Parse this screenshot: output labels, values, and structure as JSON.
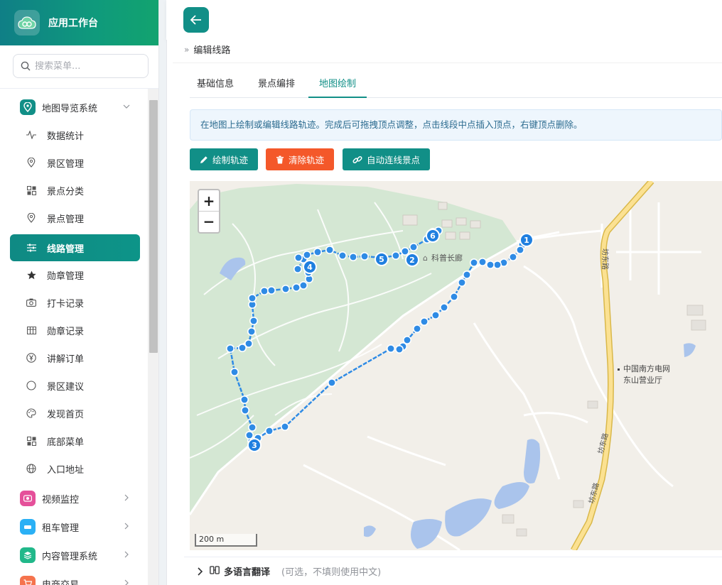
{
  "brand": {
    "title": "应用工作台"
  },
  "search": {
    "placeholder": "搜索菜单..."
  },
  "sidebar": {
    "group": {
      "label": "地图导览系统",
      "icon": "map-pin-icon"
    },
    "items": [
      {
        "label": "数据统计",
        "icon": "activity-icon"
      },
      {
        "label": "景区管理",
        "icon": "location-icon"
      },
      {
        "label": "景点分类",
        "icon": "grid-icon"
      },
      {
        "label": "景点管理",
        "icon": "location-icon"
      },
      {
        "label": "线路管理",
        "icon": "sliders-icon"
      },
      {
        "label": "勋章管理",
        "icon": "star-icon"
      },
      {
        "label": "打卡记录",
        "icon": "camera-icon"
      },
      {
        "label": "勋章记录",
        "icon": "table-icon"
      },
      {
        "label": "讲解订单",
        "icon": "yen-icon"
      },
      {
        "label": "景区建议",
        "icon": "circle-icon"
      },
      {
        "label": "发现首页",
        "icon": "palette-icon"
      },
      {
        "label": "底部菜单",
        "icon": "grid-icon"
      },
      {
        "label": "入口地址",
        "icon": "globe-icon"
      }
    ],
    "groups": [
      {
        "label": "视频监控",
        "color": "#e5509a"
      },
      {
        "label": "租车管理",
        "color": "#2ab0f5"
      },
      {
        "label": "内容管理系统",
        "color": "#21b88a"
      },
      {
        "label": "电商交易",
        "color": "#f5734d"
      }
    ]
  },
  "breadcrumb": {
    "current": "编辑线路"
  },
  "tabs": [
    {
      "label": "基础信息"
    },
    {
      "label": "景点编排"
    },
    {
      "label": "地图绘制"
    }
  ],
  "tip": "在地图上绘制或编辑线路轨迹。完成后可拖拽顶点调整，点击线段中点插入顶点，右键顶点删除。",
  "buttons": {
    "draw": "绘制轨迹",
    "clear": "清除轨迹",
    "auto": "自动连线景点"
  },
  "colors": {
    "accent": "#118f87",
    "danger": "#f4582a",
    "route": "#2f8be5"
  },
  "map": {
    "zoom_in": "+",
    "zoom_out": "−",
    "scale": "200 m",
    "poi_pavilion": "科普长廊",
    "poi_grid_line1": "中国南方电网",
    "poi_grid_line2": "东山营业厅",
    "road_1": "坊东路",
    "road_2": "坊东路",
    "road_3": "坊东路",
    "markers": [
      "1",
      "2",
      "3",
      "4",
      "5",
      "6"
    ]
  },
  "multilang": {
    "title": "多语言翻译",
    "hint": "(可选，不填则使用中文)"
  }
}
